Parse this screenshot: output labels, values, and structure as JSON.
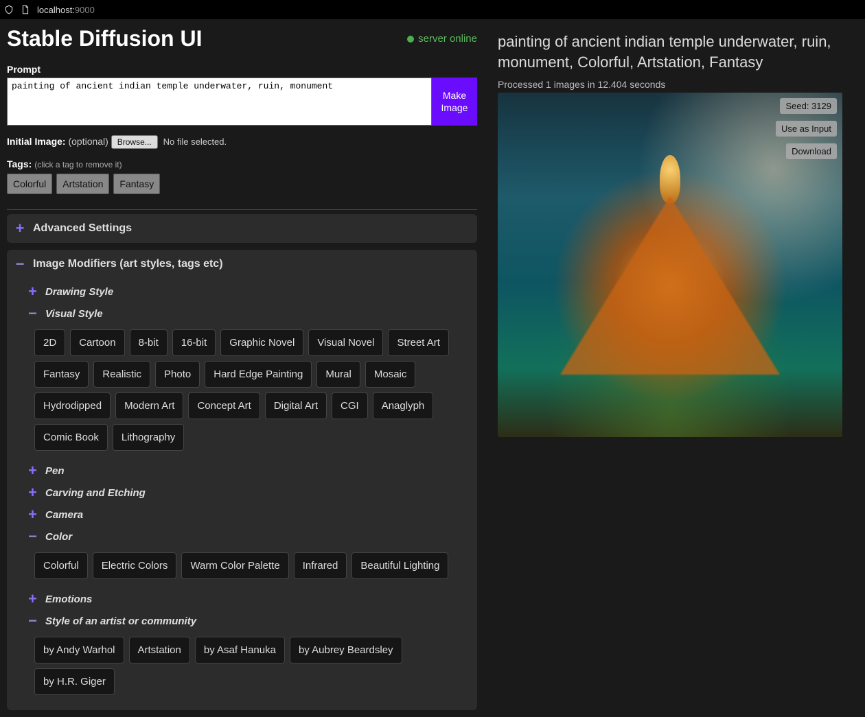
{
  "browser": {
    "host": "localhost:",
    "port": "9000"
  },
  "header": {
    "title": "Stable Diffusion UI",
    "server_status": "server online"
  },
  "prompt": {
    "label": "Prompt",
    "value": "painting of ancient indian temple underwater, ruin, monument",
    "make_button": "Make\nImage"
  },
  "initial_image": {
    "label": "Initial Image:",
    "optional": "(optional)",
    "browse": "Browse...",
    "no_file": "No file selected."
  },
  "tags": {
    "label": "Tags:",
    "hint": "(click a tag to remove it)",
    "items": [
      "Colorful",
      "Artstation",
      "Fantasy"
    ]
  },
  "advanced": {
    "title": "Advanced Settings"
  },
  "modifiers": {
    "title": "Image Modifiers (art styles, tags etc)",
    "sections": [
      {
        "name": "Drawing Style",
        "expanded": false
      },
      {
        "name": "Visual Style",
        "expanded": true,
        "tags": [
          "2D",
          "Cartoon",
          "8-bit",
          "16-bit",
          "Graphic Novel",
          "Visual Novel",
          "Street Art",
          "Fantasy",
          "Realistic",
          "Photo",
          "Hard Edge Painting",
          "Mural",
          "Mosaic",
          "Hydrodipped",
          "Modern Art",
          "Concept Art",
          "Digital Art",
          "CGI",
          "Anaglyph",
          "Comic Book",
          "Lithography"
        ]
      },
      {
        "name": "Pen",
        "expanded": false
      },
      {
        "name": "Carving and Etching",
        "expanded": false
      },
      {
        "name": "Camera",
        "expanded": false
      },
      {
        "name": "Color",
        "expanded": true,
        "tags": [
          "Colorful",
          "Electric Colors",
          "Warm Color Palette",
          "Infrared",
          "Beautiful Lighting"
        ]
      },
      {
        "name": "Emotions",
        "expanded": false
      },
      {
        "name": "Style of an artist or community",
        "expanded": true,
        "tags": [
          "by Andy Warhol",
          "Artstation",
          "by Asaf Hanuka",
          "by Aubrey Beardsley",
          "by H.R. Giger"
        ]
      }
    ]
  },
  "result": {
    "title": "painting of ancient indian temple underwater, ruin, monument, Colorful, Artstation, Fantasy",
    "status": "Processed 1 images in 12.404 seconds",
    "seed_label": "Seed: 3129",
    "use_input": "Use as Input",
    "download": "Download"
  }
}
